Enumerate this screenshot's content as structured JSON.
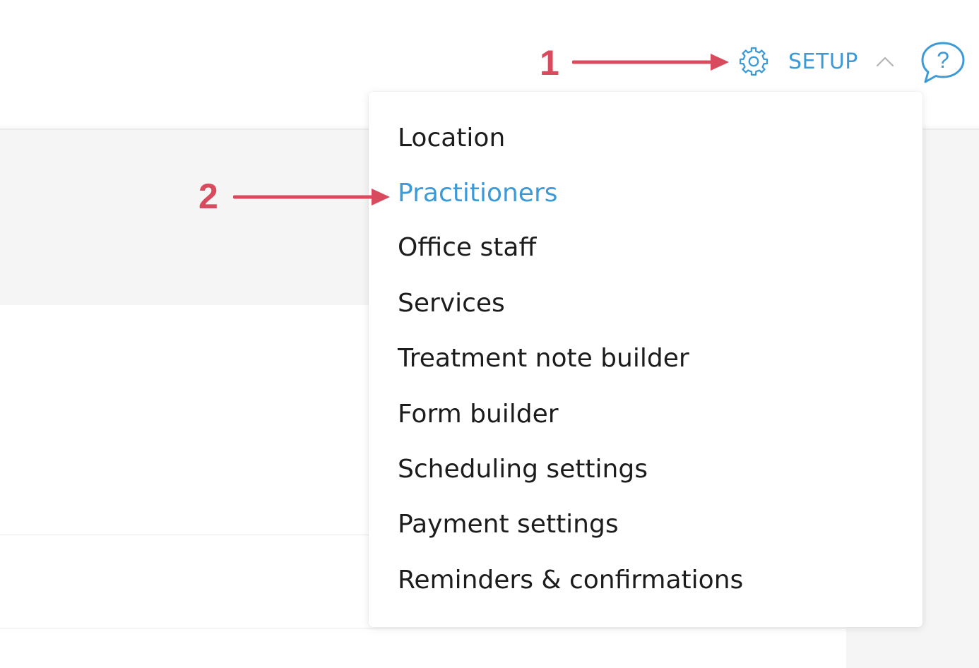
{
  "header": {
    "setup_label": "SETUP",
    "icons": {
      "settings": "gear-icon",
      "toggle": "chevron-up-icon",
      "help": "help-bubble-icon"
    },
    "help_glyph": "?"
  },
  "setup_menu": {
    "items": [
      {
        "label": "Location",
        "active": false
      },
      {
        "label": "Practitioners",
        "active": true
      },
      {
        "label": "Office staff",
        "active": false
      },
      {
        "label": "Services",
        "active": false
      },
      {
        "label": "Treatment note builder",
        "active": false
      },
      {
        "label": "Form builder",
        "active": false
      },
      {
        "label": "Scheduling settings",
        "active": false
      },
      {
        "label": "Payment settings",
        "active": false
      },
      {
        "label": "Reminders & confirmations",
        "active": false
      }
    ]
  },
  "annotations": {
    "step_1": "1",
    "step_2": "2"
  },
  "colors": {
    "accent": "#3d9ad6",
    "annotation": "#d84a5d",
    "menu_text": "#1c1c1c",
    "page_band": "#f5f5f5"
  }
}
